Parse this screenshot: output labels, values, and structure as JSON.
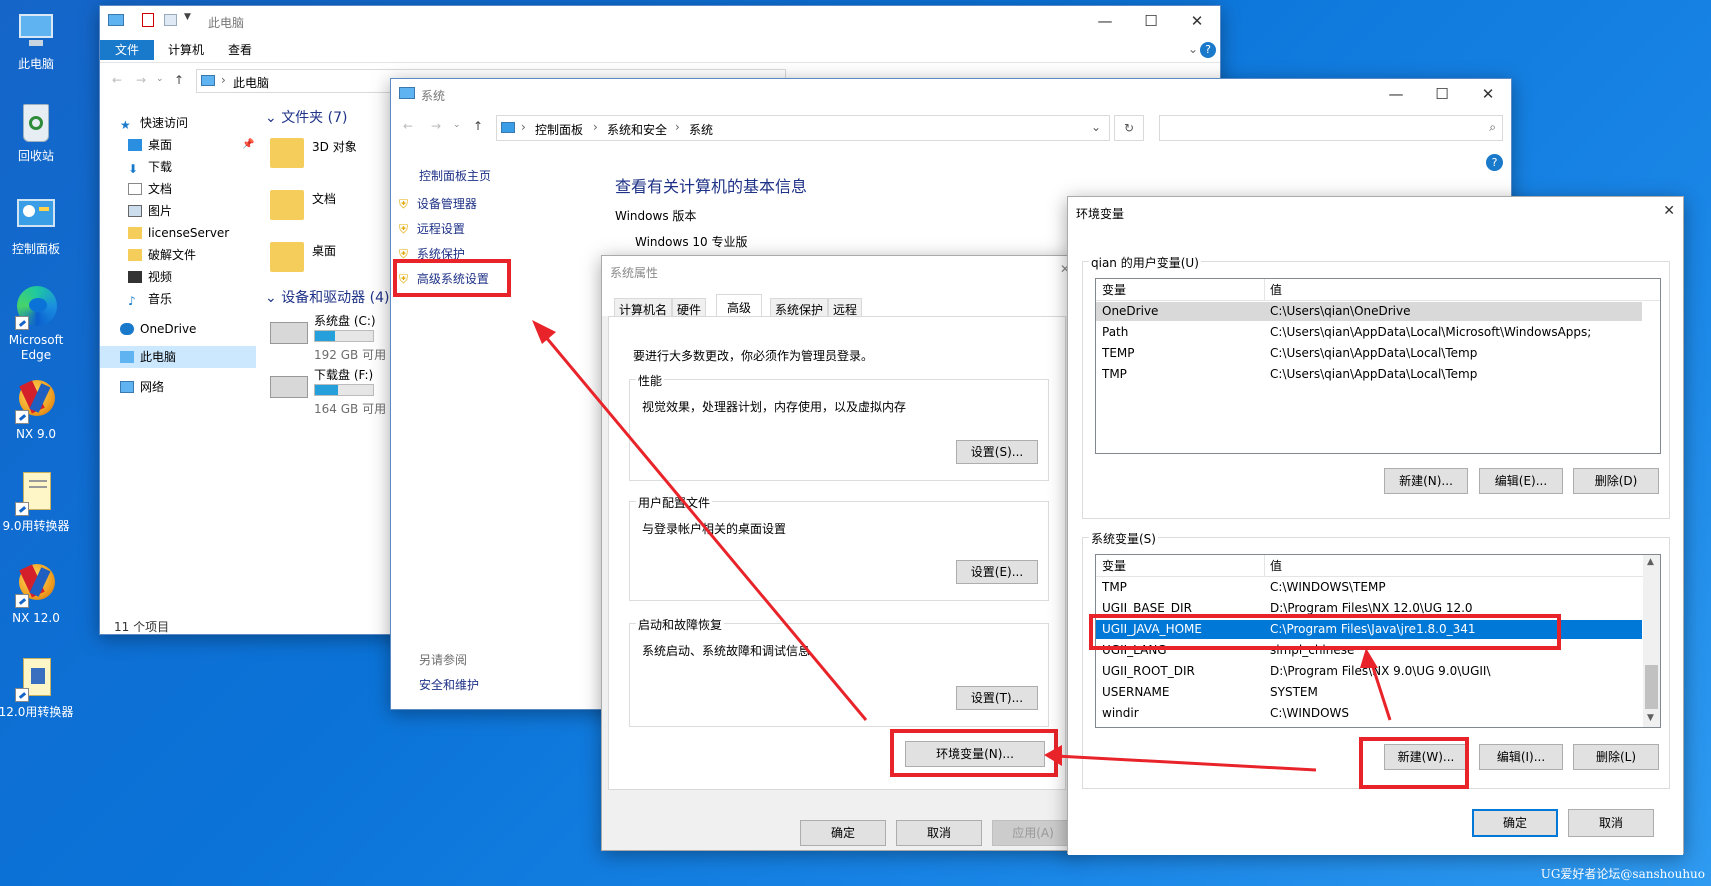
{
  "desktop": {
    "icons": [
      {
        "label": "此电脑",
        "icon": "this-pc-icon"
      },
      {
        "label": "回收站",
        "icon": "recycle-bin-icon"
      },
      {
        "label": "控制面板",
        "icon": "control-panel-icon"
      },
      {
        "label": "Microsoft Edge",
        "label_line1": "Microsoft",
        "label_line2": "Edge",
        "icon": "edge-icon"
      },
      {
        "label": "NX 9.0",
        "icon": "nx-icon"
      },
      {
        "label": "9.0用转换器",
        "icon": "batch-file-icon"
      },
      {
        "label": "NX 12.0",
        "icon": "nx-icon"
      },
      {
        "label": "12.0用转换器",
        "icon": "batch-file-icon"
      }
    ],
    "watermark": "UG爱好者论坛@sanshouhuo"
  },
  "explorer": {
    "title": "此电脑",
    "ribbon_tabs": [
      "文件",
      "计算机",
      "查看"
    ],
    "address": "此电脑",
    "nav": [
      {
        "label": "快速访问",
        "icon": "star-icon"
      },
      {
        "label": "桌面",
        "icon": "desktop-folder-icon",
        "pinned": true
      },
      {
        "label": "下载",
        "icon": "download-icon",
        "pinned": true
      },
      {
        "label": "文档",
        "icon": "document-icon",
        "pinned": true
      },
      {
        "label": "图片",
        "icon": "pictures-icon",
        "pinned": true
      },
      {
        "label": "licenseServer",
        "icon": "folder-icon"
      },
      {
        "label": "破解文件",
        "icon": "folder-icon"
      },
      {
        "label": "视频",
        "icon": "video-icon"
      },
      {
        "label": "音乐",
        "icon": "music-icon"
      },
      {
        "label": "OneDrive",
        "icon": "onedrive-icon"
      },
      {
        "label": "此电脑",
        "icon": "this-pc-icon"
      },
      {
        "label": "网络",
        "icon": "network-icon"
      }
    ],
    "folders_header": "文件夹 (7)",
    "folders": [
      "3D 对象",
      "文档",
      "桌面"
    ],
    "drives_header": "设备和驱动器 (4)",
    "drives": [
      {
        "name": "系统盘 (C:)",
        "free": "192 GB 可用",
        "fill": 0.35
      },
      {
        "name": "下载盘 (F:)",
        "free": "164 GB 可用",
        "fill": 0.4
      }
    ],
    "status": "11 个项目"
  },
  "system_window": {
    "title": "系统",
    "breadcrumb": [
      "控制面板",
      "系统和安全",
      "系统"
    ],
    "side_links": {
      "home": "控制面板主页",
      "items": [
        "设备管理器",
        "远程设置",
        "系统保护",
        "高级系统设置"
      ],
      "see_also": "另请参阅",
      "security": "安全和维护"
    },
    "heading": "查看有关计算机的基本信息",
    "edition_label": "Windows 版本",
    "edition": "Windows 10 专业版"
  },
  "sys_props": {
    "title": "系统属性",
    "tabs": [
      "计算机名",
      "硬件",
      "高级",
      "系统保护",
      "远程"
    ],
    "active_tab": "高级",
    "admin_note": "要进行大多数更改，你必须作为管理员登录。",
    "perf": {
      "label": "性能",
      "desc": "视觉效果，处理器计划，内存使用，以及虚拟内存",
      "button": "设置(S)..."
    },
    "profile": {
      "label": "用户配置文件",
      "desc": "与登录帐户相关的桌面设置",
      "button": "设置(E)..."
    },
    "startup": {
      "label": "启动和故障恢复",
      "desc": "系统启动、系统故障和调试信息",
      "button": "设置(T)..."
    },
    "env_button": "环境变量(N)...",
    "ok": "确定",
    "cancel": "取消",
    "apply": "应用(A)"
  },
  "env_vars": {
    "title": "环境变量",
    "user_group": "qian 的用户变量(U)",
    "col_var": "变量",
    "col_val": "值",
    "user_vars": [
      {
        "name": "OneDrive",
        "value": "C:\\Users\\qian\\OneDrive"
      },
      {
        "name": "Path",
        "value": "C:\\Users\\qian\\AppData\\Local\\Microsoft\\WindowsApps;"
      },
      {
        "name": "TEMP",
        "value": "C:\\Users\\qian\\AppData\\Local\\Temp"
      },
      {
        "name": "TMP",
        "value": "C:\\Users\\qian\\AppData\\Local\\Temp"
      }
    ],
    "user_buttons": [
      "新建(N)...",
      "编辑(E)...",
      "删除(D)"
    ],
    "sys_group": "系统变量(S)",
    "sys_vars": [
      {
        "name": "TMP",
        "value": "C:\\WINDOWS\\TEMP"
      },
      {
        "name": "UGII_BASE_DIR",
        "value": "D:\\Program Files\\NX 12.0\\UG 12.0"
      },
      {
        "name": "UGII_JAVA_HOME",
        "value": "C:\\Program Files\\Java\\jre1.8.0_341"
      },
      {
        "name": "UGII_LANG",
        "value": "simpl_chinese"
      },
      {
        "name": "UGII_ROOT_DIR",
        "value": "D:\\Program Files\\NX 9.0\\UG 9.0\\UGII\\"
      },
      {
        "name": "USERNAME",
        "value": "SYSTEM"
      },
      {
        "name": "windir",
        "value": "C:\\WINDOWS"
      }
    ],
    "selected_sys_var": "UGII_JAVA_HOME",
    "sys_buttons": [
      "新建(W)...",
      "编辑(I)...",
      "删除(L)"
    ],
    "ok": "确定",
    "cancel": "取消"
  },
  "colors": {
    "annotation": "#e8242a",
    "selection": "#0078d7",
    "desktop": "#0b73d8"
  }
}
